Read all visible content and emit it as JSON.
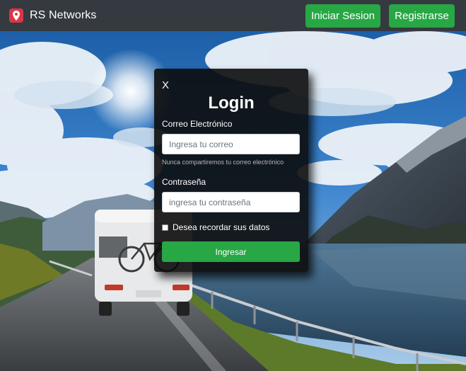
{
  "navbar": {
    "brand_name": "RS Networks",
    "brand_icon": "map-marker-icon",
    "login_label": "Iniciar Sesion",
    "register_label": "Registrarse"
  },
  "login_modal": {
    "close_label": "X",
    "title": "Login",
    "email_label": "Correo Electrónico",
    "email_placeholder": "Ingresa tu correo",
    "email_value": "",
    "email_help": "Nunca compartiremos tu correo electrónico",
    "password_label": "Contraseña",
    "password_placeholder": "ingresa tu contraseña",
    "password_value": "",
    "remember_label": "Desea recordar sus datos",
    "remember_checked": false,
    "submit_label": "Ingresar"
  },
  "colors": {
    "navbar_bg": "#343a40",
    "success_green": "#28a745",
    "brand_red": "#dc3545",
    "modal_bg": "rgba(12,12,12,0.90)"
  }
}
